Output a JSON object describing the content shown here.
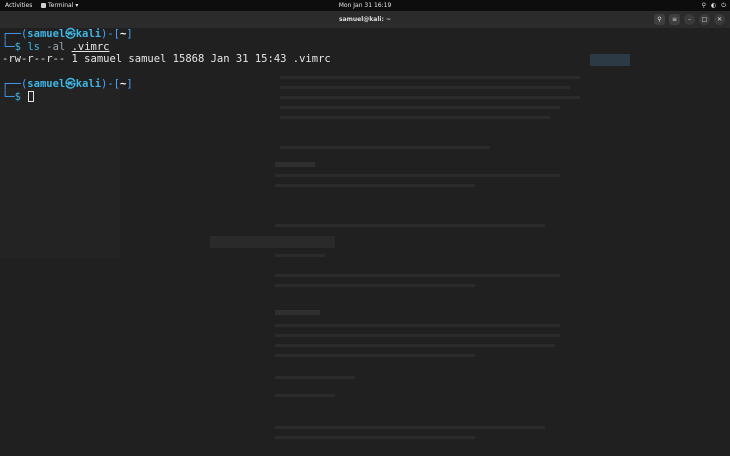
{
  "topbar": {
    "activities": "Activities",
    "app_name": "Terminal",
    "clock": "Mon Jan 31  16:19",
    "tray": [
      "⚲",
      "◐",
      "⏻"
    ]
  },
  "window": {
    "title": "samuel@kali: ~"
  },
  "terminal": {
    "prompt1": {
      "corner_top": "┌──(",
      "user": "samuel",
      "at": "㉿",
      "host": "kali",
      "sep": ")-[",
      "dir": "~",
      "end": "]",
      "corner_bottom": "└─",
      "dollar": "$ ",
      "cmd": "ls",
      "flags": " -al ",
      "arg": ".vimrc"
    },
    "output": "-rw-r--r-- 1 samuel samuel 15868 Jan 31 15:43 .vimrc",
    "prompt2": {
      "corner_top": "┌──(",
      "user": "samuel",
      "at": "㉿",
      "host": "kali",
      "sep": ")-[",
      "dir": "~",
      "end": "]",
      "corner_bottom": "└─",
      "dollar": "$ "
    }
  }
}
